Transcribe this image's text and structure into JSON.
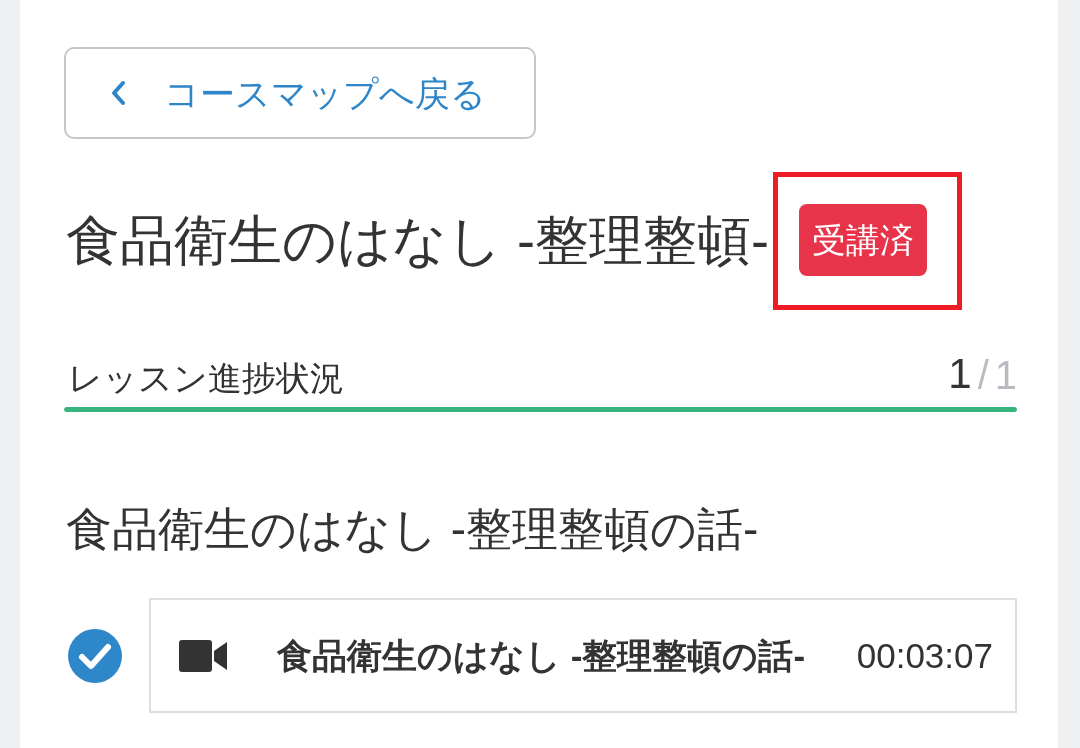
{
  "back_link": {
    "label": "コースマップへ戻る"
  },
  "course": {
    "title": "食品衛生のはなし -整理整頓-",
    "status_badge": "受講済",
    "highlighted": true
  },
  "progress": {
    "label": "レッスン進捗状況",
    "completed": "1",
    "separator": "/",
    "total": "1",
    "level": 1
  },
  "sections": [
    {
      "title": "食品衛生のはなし -整理整頓の話-",
      "lessons": [
        {
          "kind": "video",
          "title": "食品衛生のはなし -整理整頓の話-",
          "duration": "00:03:07",
          "completed": true
        }
      ]
    }
  ]
}
